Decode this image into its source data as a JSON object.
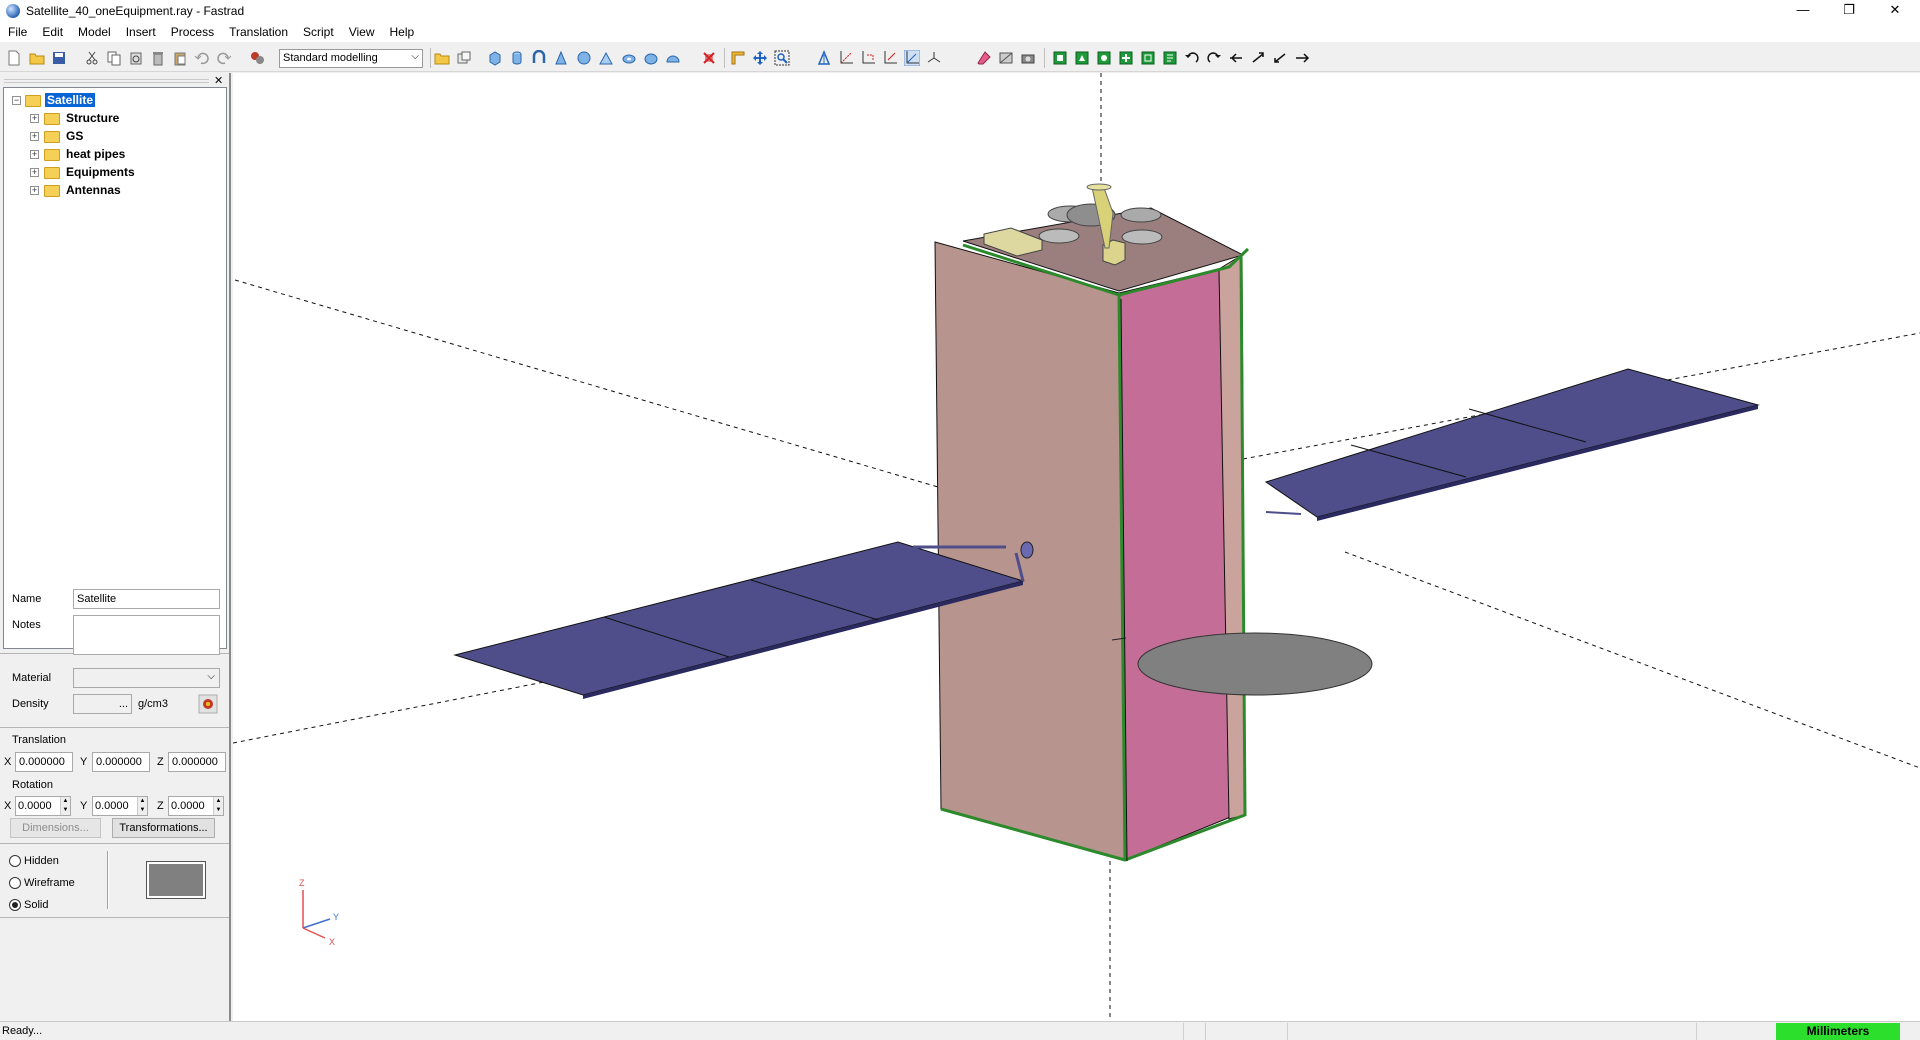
{
  "window": {
    "title": "Satellite_40_oneEquipment.ray - Fastrad",
    "min": "—",
    "max": "❐",
    "close": "✕"
  },
  "menu": [
    "File",
    "Edit",
    "Model",
    "Insert",
    "Process",
    "Translation",
    "Script",
    "View",
    "Help"
  ],
  "toolbar": {
    "mode_select": "Standard modelling"
  },
  "tree": {
    "root": "Satellite",
    "children": [
      "Structure",
      "GS",
      "heat pipes",
      "Equipments",
      "Antennas"
    ]
  },
  "properties": {
    "name_label": "Name",
    "name_value": "Satellite",
    "notes_label": "Notes",
    "material_label": "Material",
    "density_label": "Density",
    "density_value": "...",
    "density_unit": "g/cm3",
    "translation_label": "Translation",
    "translation": {
      "x_label": "X",
      "x": "0.000000",
      "y_label": "Y",
      "y": "0.000000",
      "z_label": "Z",
      "z": "0.000000"
    },
    "rotation_label": "Rotation",
    "rotation": {
      "x_label": "X",
      "x": "0.0000",
      "y_label": "Y",
      "y": "0.0000",
      "z_label": "Z",
      "z": "0.0000"
    },
    "dimensions_button": "Dimensions...",
    "transformations_button": "Transformations...",
    "display_hidden": "Hidden",
    "display_wireframe": "Wireframe",
    "display_solid": "Solid",
    "display_mode": "Solid",
    "color_swatch": "#808080"
  },
  "axes_triad": {
    "z": "Z",
    "y": "Y",
    "x": "X"
  },
  "colors": {
    "panel_body_front": "#b8948e",
    "panel_body_side": "#c46e97",
    "solar_panel": "#4f4e8a",
    "dish": "#808080",
    "edge_green": "#2c8a2c"
  },
  "status": {
    "text": "Ready...",
    "units": "Millimeters"
  }
}
